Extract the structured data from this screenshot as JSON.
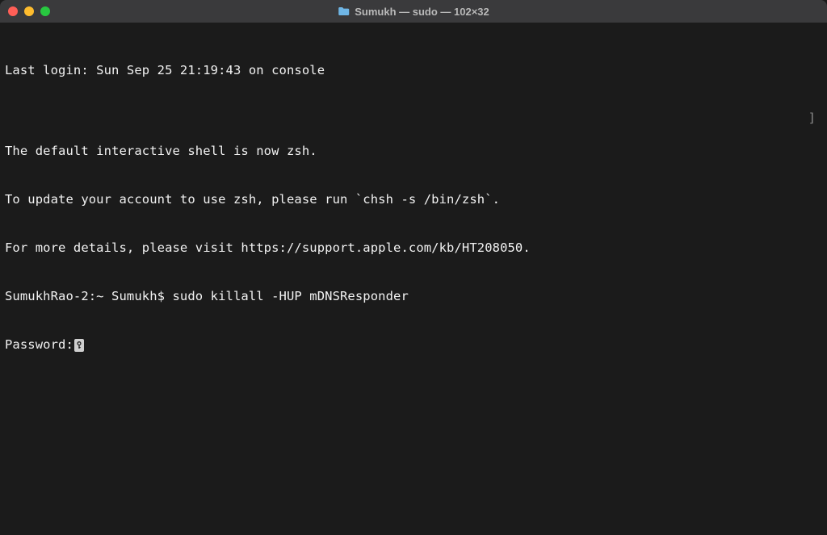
{
  "titlebar": {
    "title": "Sumukh — sudo — 102×32",
    "folder_icon": "folder-icon"
  },
  "terminal": {
    "lines": [
      "Last login: Sun Sep 25 21:19:43 on console",
      "",
      "The default interactive shell is now zsh.",
      "To update your account to use zsh, please run `chsh -s /bin/zsh`.",
      "For more details, please visit https://support.apple.com/kb/HT208050."
    ],
    "prompt": "SumukhRao-2:~ Sumukh$ ",
    "command": "sudo killall -HUP mDNSResponder",
    "password_label": "Password:",
    "right_bracket": "]"
  }
}
